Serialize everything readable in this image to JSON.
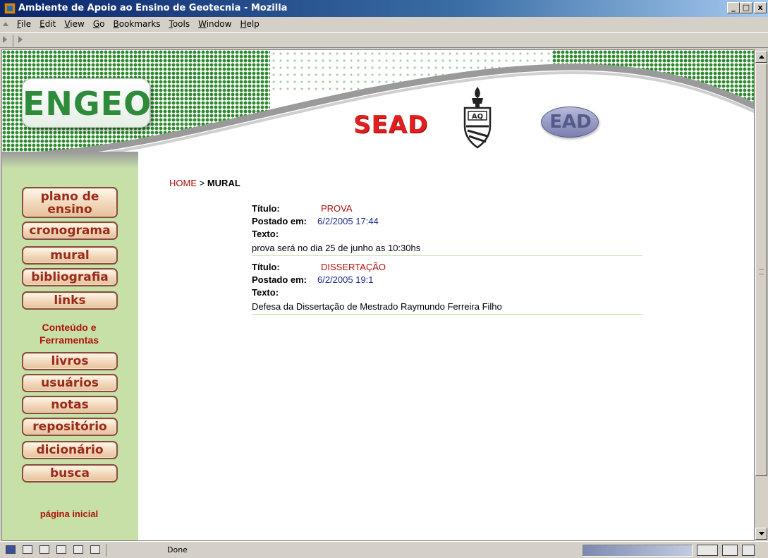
{
  "window": {
    "title": "Ambiente de Apoio ao Ensino de Geotecnia - Mozilla",
    "controls": [
      "_",
      "□",
      "x"
    ]
  },
  "menu": {
    "items": [
      {
        "label": "File",
        "accel": "F"
      },
      {
        "label": "Edit",
        "accel": "E"
      },
      {
        "label": "View",
        "accel": "V"
      },
      {
        "label": "Go",
        "accel": "G"
      },
      {
        "label": "Bookmarks",
        "accel": "B"
      },
      {
        "label": "Tools",
        "accel": "T"
      },
      {
        "label": "Window",
        "accel": "W"
      },
      {
        "label": "Help",
        "accel": "H"
      }
    ]
  },
  "header": {
    "logo": "ENGEO",
    "sead": "SEAD",
    "ead": "EAD",
    "crest_text": "AQ"
  },
  "sidebar": {
    "nav": [
      {
        "label": "plano de ensino"
      },
      {
        "label": "cronograma"
      },
      {
        "label": "mural"
      },
      {
        "label": "bibliografia"
      },
      {
        "label": "links"
      }
    ],
    "section_heading": "Conteúdo e Ferramentas",
    "tools": [
      {
        "label": "livros"
      },
      {
        "label": "usuários"
      },
      {
        "label": "notas"
      },
      {
        "label": "repositório"
      },
      {
        "label": "dicionário"
      },
      {
        "label": "busca"
      }
    ],
    "footer_link": "página inicial"
  },
  "breadcrumb": {
    "home": "HOME",
    "separator": ">",
    "current": "MURAL"
  },
  "labels": {
    "titulo": "Título:",
    "postado": "Postado em:",
    "texto": "Texto:"
  },
  "posts": [
    {
      "titulo": "PROVA",
      "postado_em": "6/2/2005 17:44",
      "texto": "prova será no dia 25 de junho as 10:30hs"
    },
    {
      "titulo": "DISSERTAÇÃO",
      "postado_em": "6/2/2005 19:1",
      "texto": "Defesa da Dissertação de Mestrado Raymundo Ferreira Filho"
    }
  ],
  "status": {
    "text": "Done"
  },
  "colors": {
    "title_bar": "#0a246a",
    "accent_red": "#b0120a",
    "date_blue": "#1a2a8a",
    "sidebar_green": "#c6e0a8",
    "logo_green": "#2e8b3a"
  }
}
